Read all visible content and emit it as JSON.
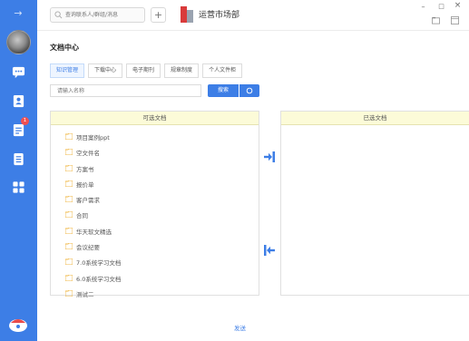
{
  "search": {
    "placeholder": "查询联系人/群组/消息"
  },
  "topbar": {
    "add_label": "+",
    "department": "运营市场部",
    "restore_glyph": "□",
    "close_glyph": "×"
  },
  "page": {
    "title": "文档中心"
  },
  "tabs": [
    {
      "label": "知识管理",
      "active": true
    },
    {
      "label": "下载中心",
      "active": false
    },
    {
      "label": "电子期刊",
      "active": false
    },
    {
      "label": "规章制度",
      "active": false
    },
    {
      "label": "个人文件柜",
      "active": false
    }
  ],
  "filter": {
    "placeholder": "请输入名称",
    "search_label": "搜索"
  },
  "available": {
    "title": "可选文档",
    "items": [
      "项目案例ppt",
      "空文件名",
      "方案书",
      "报价单",
      "客户需求",
      "合同",
      "华天软文精选",
      "会议纪要",
      "7.0系统学习文档",
      "6.0系统学习文档",
      "测试二"
    ]
  },
  "selected": {
    "title": "已选文档",
    "items": []
  },
  "actions": {
    "send_label": "发送"
  },
  "rail": {
    "badge_count": "1"
  },
  "colors": {
    "accent": "#3d7ee6",
    "panel_header": "#fcfbd8",
    "folder": "#f0b94a",
    "badge": "#f15050"
  },
  "icons": [
    "collapse-arrow-icon",
    "chat-icon",
    "contacts-icon",
    "approval-icon",
    "document-icon",
    "apps-icon",
    "app-logo-icon",
    "search-icon",
    "reload-icon",
    "folder-icon",
    "move-right-icon",
    "move-left-icon"
  ]
}
